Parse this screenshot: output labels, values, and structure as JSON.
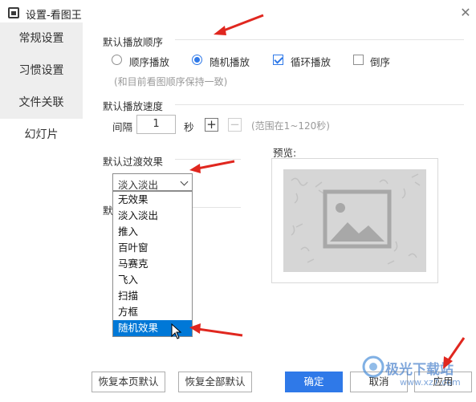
{
  "window": {
    "title": "设置-看图王"
  },
  "sidebar": {
    "items": [
      {
        "label": "常规设置"
      },
      {
        "label": "习惯设置"
      },
      {
        "label": "文件关联"
      },
      {
        "label": "幻灯片"
      }
    ],
    "active_index": 3
  },
  "play_order": {
    "title": "默认播放顺序",
    "options": [
      {
        "label": "顺序播放",
        "selected": false
      },
      {
        "label": "随机播放",
        "selected": true
      }
    ],
    "loop": {
      "label": "循环播放",
      "checked": true
    },
    "reverse": {
      "label": "倒序",
      "checked": false
    },
    "hint": "(和目前看图顺序保持一致)"
  },
  "play_speed": {
    "title": "默认播放速度",
    "interval_label": "间隔",
    "value": "1",
    "unit": "秒",
    "plus": "+",
    "minus": "−",
    "hint": "(范围在1~120秒)"
  },
  "transition": {
    "title": "默认过渡效果",
    "selected": "淡入淡出",
    "options": [
      "无效果",
      "淡入淡出",
      "推入",
      "百叶窗",
      "马赛克",
      "飞入",
      "扫描",
      "方框",
      "随机效果"
    ],
    "highlighted_index": 8
  },
  "hidden_section_title_fragment": "默",
  "preview": {
    "label": "预览:"
  },
  "footer": {
    "restore_page": "恢复本页默认",
    "restore_all": "恢复全部默认",
    "ok": "确定",
    "cancel": "取消",
    "apply": "应用"
  },
  "watermark": {
    "text": "极光下载站",
    "url": "www.xz7.com"
  },
  "colors": {
    "accent": "#2f79e8",
    "highlight": "#0078d7",
    "annotation_arrow": "#e0271f"
  }
}
